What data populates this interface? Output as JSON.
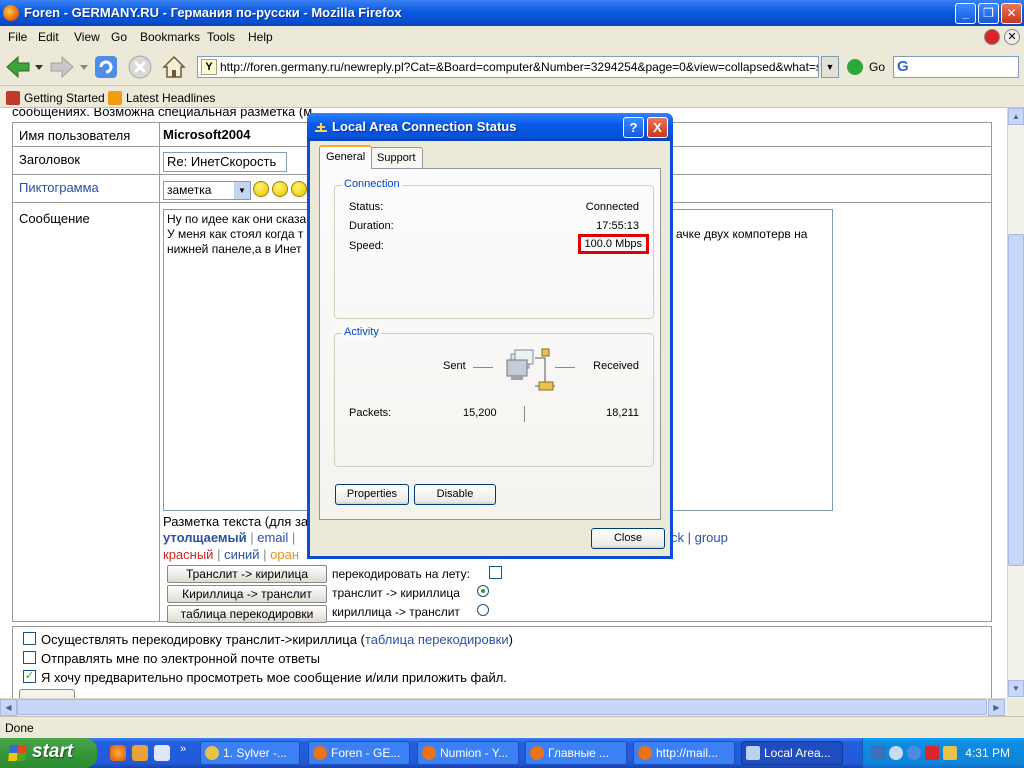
{
  "browser": {
    "title": "Foren - GERMANY.RU - Германия по-русски - Mozilla Firefox",
    "menu": [
      "File",
      "Edit",
      "View",
      "Go",
      "Bookmarks",
      "Tools",
      "Help"
    ],
    "url": "http://foren.germany.ru/newreply.pl?Cat=&Board=computer&Number=3294254&page=0&view=collapsed&what=showflat",
    "go_label": "Go",
    "search_glyph": "G",
    "bookmarks": [
      "Getting Started",
      "Latest Headlines"
    ],
    "status": "Done"
  },
  "page": {
    "top_text": "сообщениях. Возможна специальная разметка (м",
    "top_link": "...их сообщениях.",
    "username_label": "Имя пользователя",
    "username": "Microsoft2004",
    "subject_label": "Заголовок",
    "subject_value": "Re: ИнетСкорость",
    "icon_label": "Пиктограмма",
    "icon_select": "заметка",
    "message_label": "Сообщение",
    "message_lines": [
      "Ну по идее как они сказа",
      "У меня как стоял когда т",
      "нижней панеле,а в Инет"
    ],
    "message_right": "ачке двух компотерв на",
    "markup_label": "Разметка текста (для за",
    "markup_bold": "утолщаемый",
    "markup_email": "email",
    "markup_right": "ck | group",
    "markup_colors": [
      "красный",
      "синий",
      "оран"
    ],
    "buttons": [
      "Транслит -> кирилица",
      "Кириллица -> транслит",
      "таблица перекодировки"
    ],
    "opt_live": "перекодировать на лету:",
    "opt_t2c": "транслит -> кириллица",
    "opt_c2t": "кириллица -> транслит",
    "bottom_opt1": "Осуществлять перекодировку транслит->кириллица (",
    "bottom_opt1_link": "таблица перекодировки",
    "bottom_opt1_end": ")",
    "bottom_opt2": "Отправлять мне по электронной почте ответы",
    "bottom_opt3": "Я хочу предварительно просмотреть мое сообщение и/или приложить файл."
  },
  "dialog": {
    "title": "Local Area Connection Status",
    "tabs": [
      "General",
      "Support"
    ],
    "connection_group": "Connection",
    "status_label": "Status:",
    "status_value": "Connected",
    "duration_label": "Duration:",
    "duration_value": "17:55:13",
    "speed_label": "Speed:",
    "speed_value": "100.0 Mbps",
    "activity_group": "Activity",
    "sent_label": "Sent",
    "received_label": "Received",
    "packets_label": "Packets:",
    "packets_sent": "15,200",
    "packets_received": "18,211",
    "properties_button": "Properties",
    "disable_button": "Disable",
    "close_button": "Close",
    "help_glyph": "?",
    "close_glyph": "X"
  },
  "taskbar": {
    "start": "start",
    "tasks": [
      "1. Sylver -...",
      "Foren - GE...",
      "Numion - Y...",
      "Главные ...",
      "http://mail...",
      "Local Area..."
    ],
    "clock": "4:31 PM"
  },
  "colors": {
    "accent": "#0a5be0",
    "link": "#2c50a4",
    "highlight_box": "#e00000"
  }
}
